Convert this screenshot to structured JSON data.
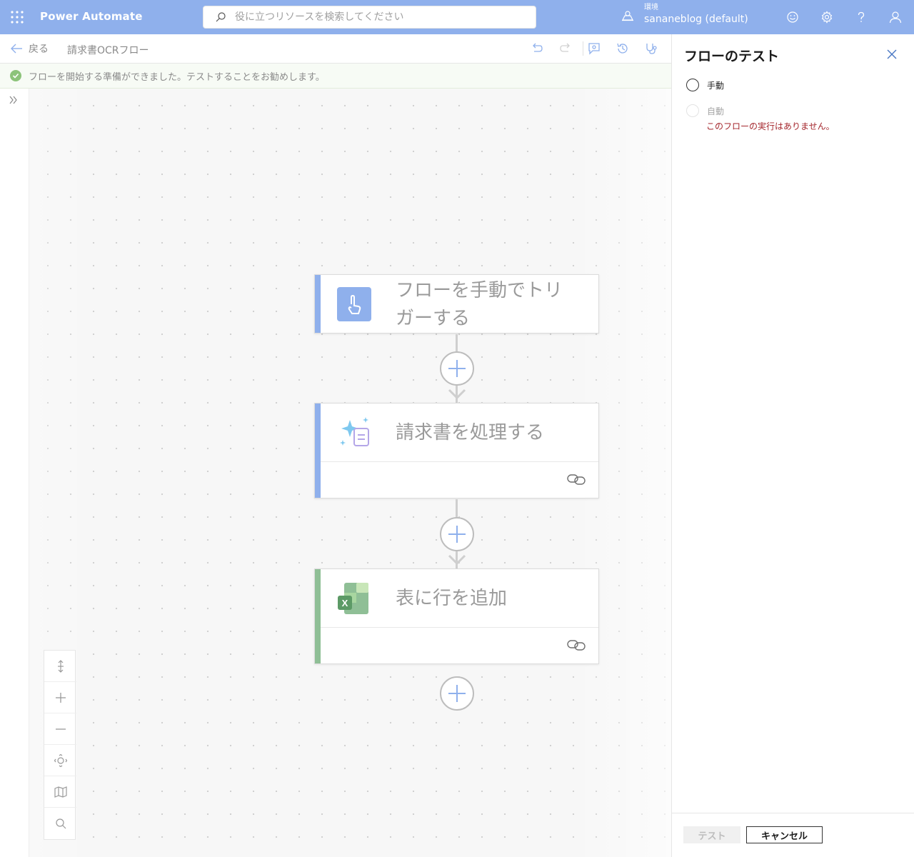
{
  "app": {
    "brand": "Power Automate",
    "search_placeholder": "役に立つリソースを検索してください",
    "env_label": "環境",
    "env_name": "sananeblog (default)",
    "header_color": "#8fb0ec"
  },
  "cmdbar": {
    "back_label": "戻る",
    "flow_name": "請求書OCRフロー"
  },
  "notice": {
    "text": "フローを開始する準備ができました。テストすることをお勧めします。",
    "status_color": "#6ab04c"
  },
  "flow": {
    "steps": [
      {
        "title_line1": "フローを手動でトリ",
        "title_line2": "ガーする",
        "accent": "#8fb0ec",
        "icon": "touch-icon"
      },
      {
        "title": "請求書を処理する",
        "accent": "#8fb0ec",
        "icon": "ai-document-icon"
      },
      {
        "title": "表に行を追加",
        "accent": "#8fbf96",
        "icon": "excel-icon"
      }
    ]
  },
  "panel": {
    "title": "フローのテスト",
    "option_manual": "手動",
    "option_auto": "自動",
    "no_runs": "このフローの実行はありません。",
    "test_button": "テスト",
    "cancel_button": "キャンセル",
    "error_color": "#a4262c"
  }
}
